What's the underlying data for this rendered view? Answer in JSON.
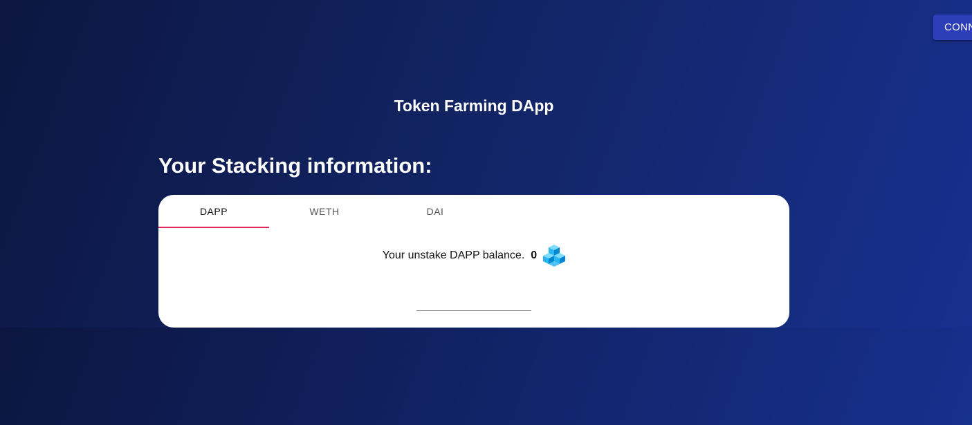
{
  "header": {
    "connect_label": "CONNECT"
  },
  "main": {
    "title": "Token Farming DApp",
    "section_heading": "Your Stacking information:",
    "tabs": [
      {
        "label": "DAPP",
        "active": true
      },
      {
        "label": "WETH",
        "active": false
      },
      {
        "label": "DAI",
        "active": false
      }
    ],
    "balance": {
      "label": "Your unstake DAPP balance.",
      "value": "0",
      "token_icon": "dapp-token-cube-icon"
    },
    "amount_input": {
      "value": "",
      "placeholder": ""
    }
  },
  "colors": {
    "background": "#13266a",
    "accent_tab_indicator": "#e0245e",
    "connect_button": "#2c3fb8",
    "card": "#ffffff",
    "token_icon": "#29b6f6"
  }
}
